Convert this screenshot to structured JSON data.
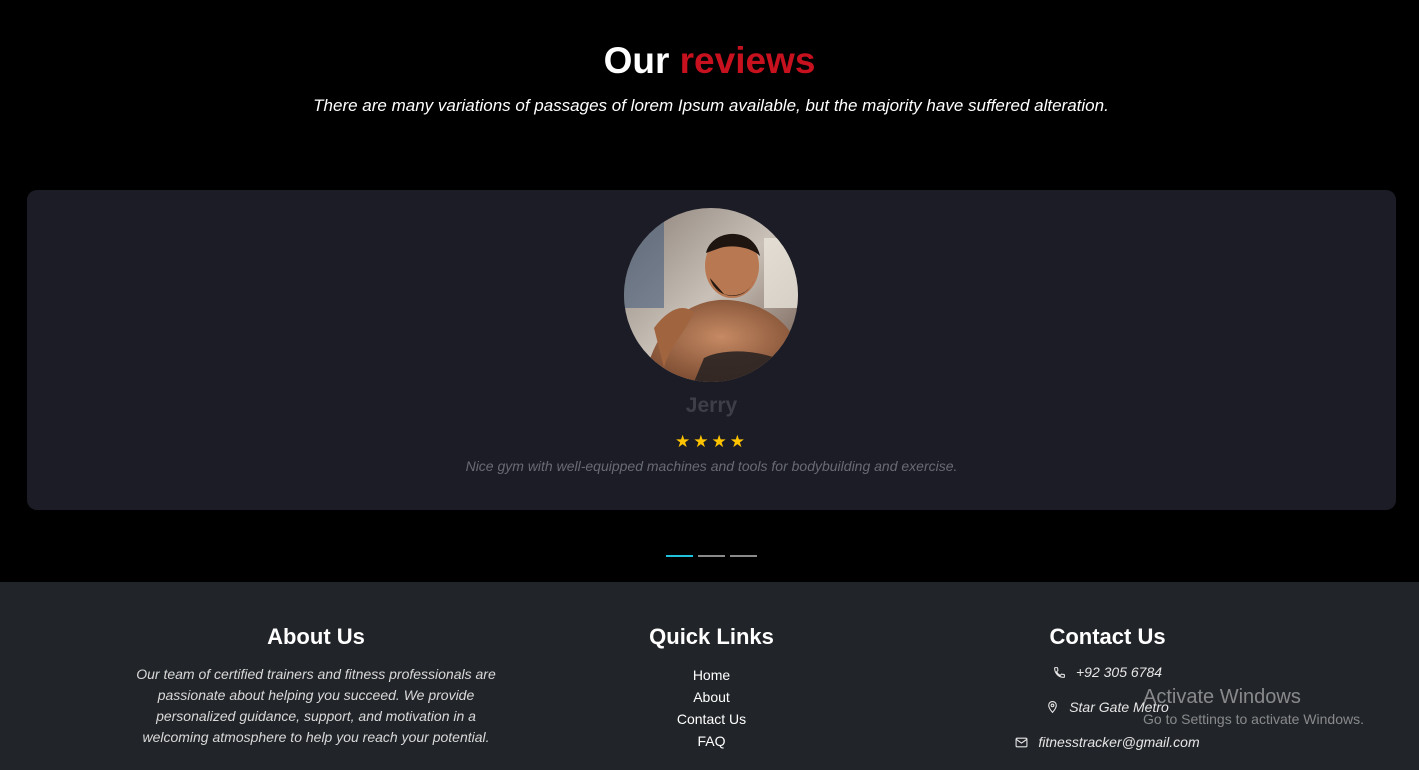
{
  "reviews": {
    "title_prefix": "Our",
    "title_accent": "reviews",
    "subtitle": "There are many variations of passages of lorem Ipsum available, but the majority have suffered alteration.",
    "card": {
      "name": "Jerry",
      "stars": "★★★★",
      "rating": 4,
      "text": "Nice gym with well-equipped machines and tools for bodybuilding and exercise."
    },
    "indicators": [
      {
        "active": true
      },
      {
        "active": false
      },
      {
        "active": false
      }
    ]
  },
  "footer": {
    "about": {
      "heading": "About Us",
      "text": "Our team of certified trainers and fitness professionals are passionate about helping you succeed. We provide personalized guidance, support, and motivation in a welcoming atmosphere to help you reach your potential."
    },
    "quick_links": {
      "heading": "Quick Links",
      "items": [
        "Home",
        "About",
        "Contact Us",
        "FAQ"
      ]
    },
    "contact": {
      "heading": "Contact Us",
      "phone": "+92 305 6784",
      "address": "Star Gate Metro",
      "email": "fitnesstracker@gmail.com"
    }
  },
  "watermark": {
    "line1": "Activate Windows",
    "line2": "Go to Settings to activate Windows."
  },
  "colors": {
    "accent": "#c8111e",
    "card_bg": "#1b1c26",
    "footer_bg": "#212428",
    "star": "#ffc400",
    "indicator_active": "#1fc3dc"
  }
}
